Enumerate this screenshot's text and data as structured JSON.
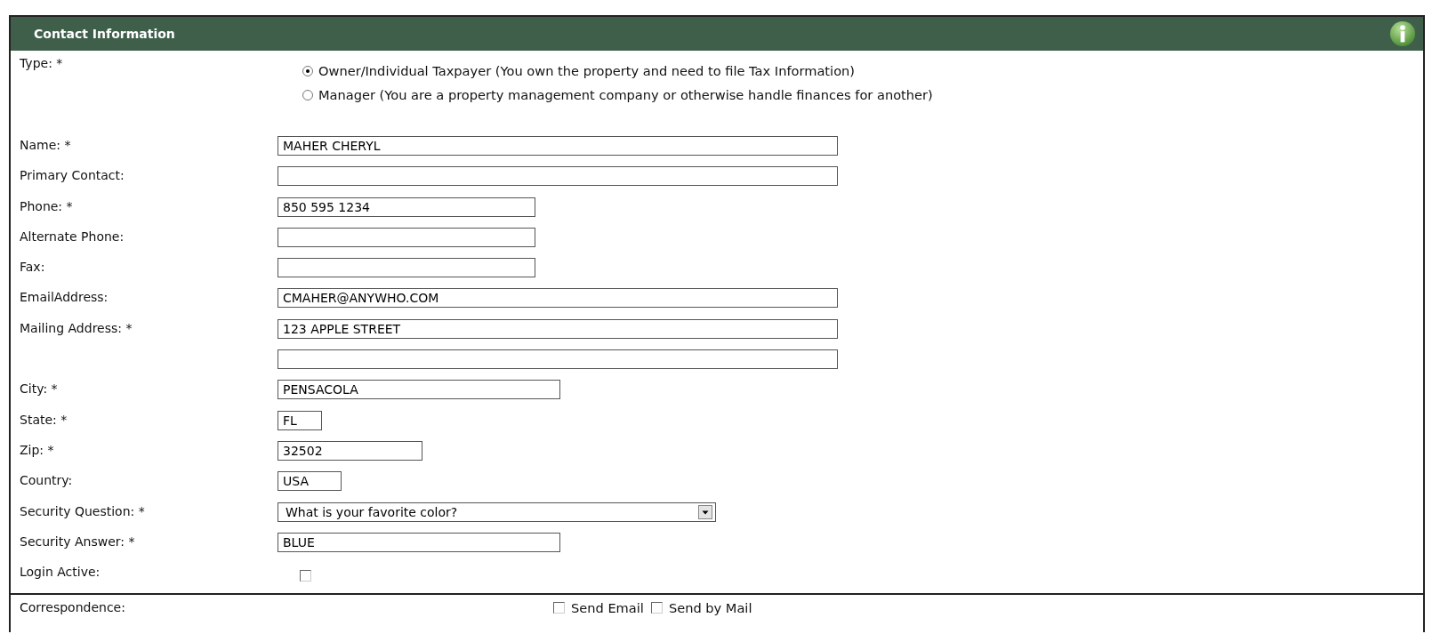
{
  "panel": {
    "title": "Contact Information"
  },
  "type": {
    "label": "Type: *",
    "options": [
      {
        "label": "Owner/Individual Taxpayer (You own the property and need to file Tax Information)",
        "selected": true
      },
      {
        "label": "Manager (You are a property management company or otherwise handle finances for another)",
        "selected": false
      }
    ]
  },
  "fields": [
    {
      "kind": "text",
      "label": "Name: *",
      "value": "MAHER CHERYL"
    },
    {
      "kind": "text",
      "label": "Primary Contact:"
    },
    {
      "kind": "text",
      "label": "Phone: *",
      "value": "850 595 1234"
    },
    {
      "kind": "text",
      "label": "Alternate Phone:"
    },
    {
      "kind": "text",
      "label": "Fax:"
    },
    {
      "kind": "text",
      "label": "EmailAddress:",
      "value": "CMAHER@ANYWHO.COM"
    },
    {
      "kind": "text",
      "label": "Mailing Address: *",
      "value": "123 APPLE STREET"
    },
    {
      "kind": "text"
    },
    {
      "kind": "text",
      "label": "City: *",
      "value": "PENSACOLA"
    },
    {
      "kind": "text",
      "label": "State: *",
      "value": "FL"
    },
    {
      "kind": "text",
      "label": "Zip: *",
      "value": "32502"
    },
    {
      "kind": "text",
      "label": "Country:",
      "value": "USA"
    },
    {
      "kind": "select",
      "label": "Security Question: *",
      "value": "What is your favorite color?"
    },
    {
      "kind": "text",
      "label": "Security Answer: *",
      "value": "BLUE"
    },
    {
      "kind": "checkbox",
      "label": "Login Active:",
      "checked": false
    }
  ],
  "correspondence": {
    "label": "Correspondence:",
    "options": [
      {
        "label": "Send Email",
        "checked": false
      },
      {
        "label": "Send by Mail",
        "checked": false
      }
    ]
  }
}
